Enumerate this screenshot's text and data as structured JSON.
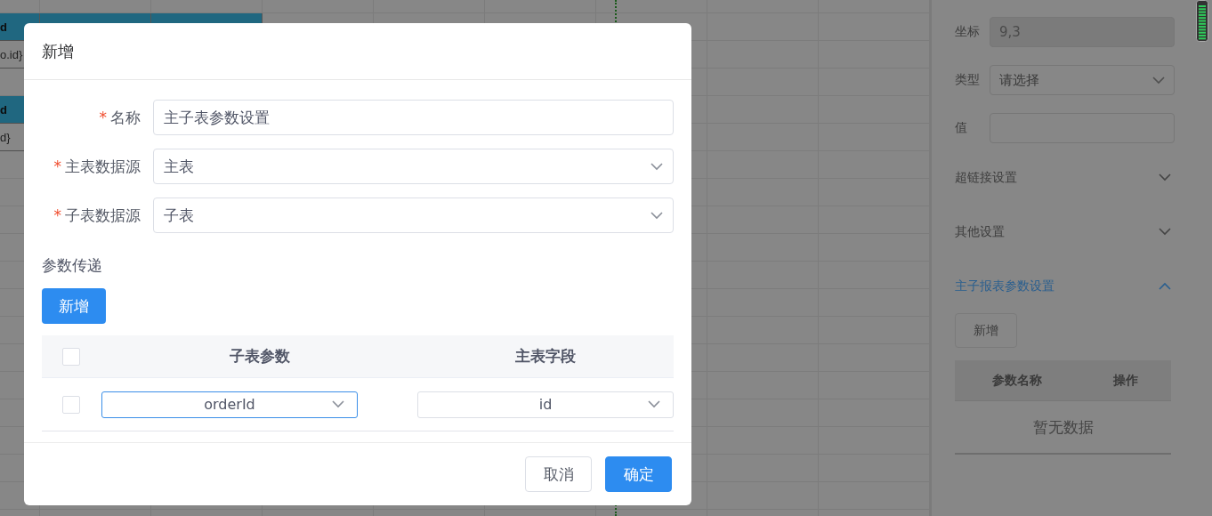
{
  "sheet": {
    "rows": [
      {
        "cells": [
          {
            "kind": "header",
            "text": "d"
          },
          {
            "kind": "header"
          },
          {
            "kind": "header"
          }
        ]
      },
      {
        "cells": [
          {
            "kind": "plain",
            "text": "o.id}"
          }
        ]
      },
      {
        "cells": [
          {
            "kind": "plain"
          }
        ]
      },
      {
        "cells": [
          {
            "kind": "header",
            "text": "d"
          }
        ]
      },
      {
        "cells": [
          {
            "kind": "plain",
            "text": "d}"
          }
        ]
      }
    ]
  },
  "dialog": {
    "title": "新增",
    "required_mark": "*",
    "fields": [
      {
        "label": "名称",
        "required": true,
        "kind": "input",
        "value": "主子表参数设置"
      },
      {
        "label": "主表数据源",
        "required": true,
        "kind": "select",
        "value": "主表"
      },
      {
        "label": "子表数据源",
        "required": true,
        "kind": "select",
        "value": "子表"
      }
    ],
    "section_title": "参数传递",
    "add_button": "新增",
    "table": {
      "columns": [
        "子表参数",
        "主表字段"
      ],
      "header_checked": false,
      "rows": [
        {
          "checked": false,
          "cells": [
            {
              "value": "orderId",
              "focused": true
            },
            {
              "value": "id",
              "focused": false
            }
          ]
        }
      ]
    },
    "buttons": [
      {
        "label": "取消",
        "kind": "default"
      },
      {
        "label": "确定",
        "kind": "primary"
      }
    ]
  },
  "panel": {
    "fields": [
      {
        "label": "坐标",
        "kind": "input",
        "value": "9,3",
        "disabled": true
      },
      {
        "label": "类型",
        "kind": "select",
        "placeholder": "请选择"
      },
      {
        "label": "值",
        "kind": "input"
      }
    ],
    "sections": [
      {
        "title": "超链接设置",
        "expanded": false
      },
      {
        "title": "其他设置",
        "expanded": false
      },
      {
        "title": "主子报表参数设置",
        "expanded": true
      }
    ],
    "add_button": "新增",
    "table": {
      "columns": [
        "参数名称",
        "操作"
      ],
      "empty": "暂无数据"
    }
  }
}
